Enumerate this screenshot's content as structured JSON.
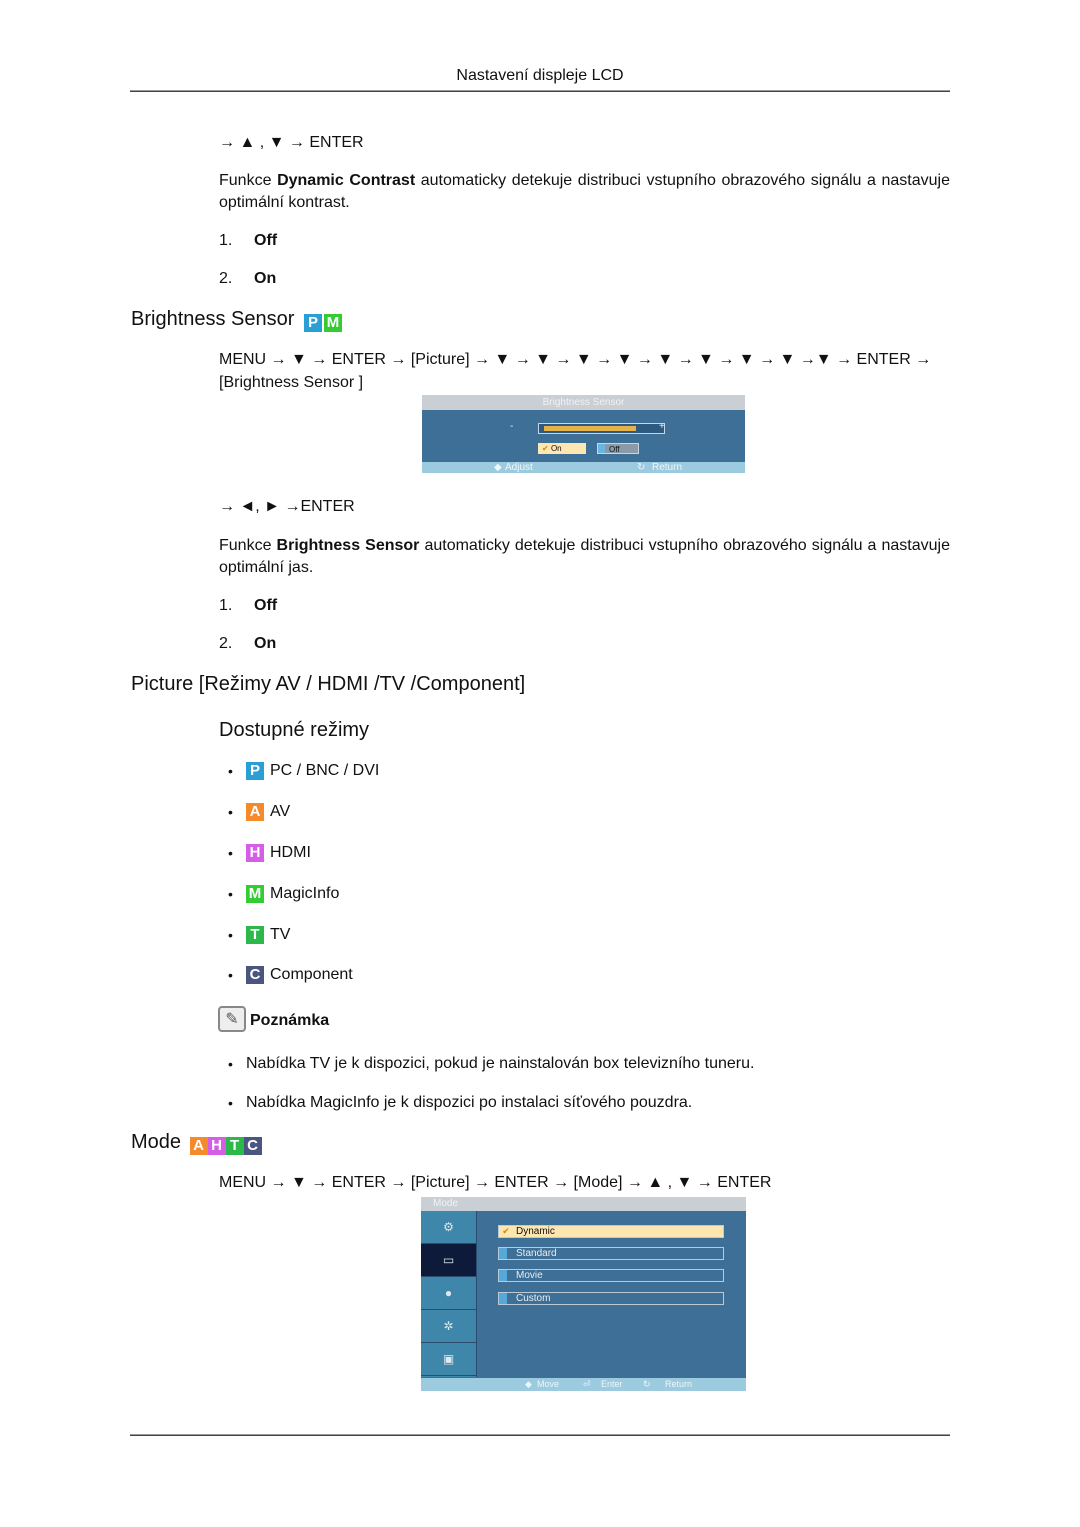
{
  "header": {
    "title": "Nastavení displeje LCD"
  },
  "dynamic_contrast": {
    "nav": "→ ▲ , ▼ → ENTER",
    "desc_prefix": "Funkce ",
    "desc_bold": "Dynamic Contrast",
    "desc_suffix": " automaticky detekuje distribuci vstupního obrazového signálu a nastavuje optimální kontrast.",
    "options": [
      {
        "num": "1.",
        "label": "Off"
      },
      {
        "num": "2.",
        "label": "On"
      }
    ]
  },
  "brightness_sensor": {
    "heading": "Brightness Sensor",
    "badges": [
      {
        "letter": "P",
        "color": "#2a9fd6"
      },
      {
        "letter": "M",
        "color": "#33cc33"
      }
    ],
    "nav_line1": "MENU → ▼ → ENTER → [Picture] → ▼ → ▼ → ▼ → ▼ → ▼ → ▼ → ▼ → ▼ →▼ → ENTER →",
    "nav_line2": "[Brightness Sensor ]",
    "osd": {
      "title": "Brightness Sensor",
      "minus": "-",
      "plus": "+",
      "level_fraction": 0.8,
      "on_label": "On",
      "off_label": "Off",
      "check": "✔",
      "footer_adjust": "Adjust",
      "footer_return": "Return"
    },
    "nav2": "→ ◄, ► →ENTER",
    "desc_prefix": "Funkce ",
    "desc_bold": "Brightness Sensor",
    "desc_suffix": "  automaticky detekuje distribuci vstupního obrazového signálu a nastavuje optimální jas.",
    "options": [
      {
        "num": "1.",
        "label": "Off"
      },
      {
        "num": "2.",
        "label": "On"
      }
    ]
  },
  "picture_modes": {
    "heading": "Picture [Režimy AV / HDMI /TV /Component]",
    "subheading": "Dostupné režimy",
    "bullet": "•",
    "modes": [
      {
        "letter": "P",
        "color": "#2a9fd6",
        "label": "PC / BNC / DVI"
      },
      {
        "letter": "A",
        "color": "#f58a2a",
        "label": "AV"
      },
      {
        "letter": "H",
        "color": "#d65ee6",
        "label": "HDMI"
      },
      {
        "letter": "M",
        "color": "#33cc33",
        "label": "MagicInfo"
      },
      {
        "letter": "T",
        "color": "#2db84a",
        "label": "TV"
      },
      {
        "letter": "C",
        "color": "#4a5580",
        "label": "Component"
      }
    ],
    "note_title": "Poznámka",
    "notes": [
      "Nabídka TV je k dispozici, pokud je nainstalován box televizního tuneru.",
      "Nabídka MagicInfo je k dispozici po instalaci síťového pouzdra."
    ]
  },
  "mode": {
    "heading": "Mode",
    "badges": [
      {
        "letter": "A",
        "color": "#f58a2a"
      },
      {
        "letter": "H",
        "color": "#d65ee6"
      },
      {
        "letter": "T",
        "color": "#2db84a"
      },
      {
        "letter": "C",
        "color": "#4a5580"
      }
    ],
    "nav": "MENU → ▼ → ENTER → [Picture] → ENTER → [Mode] → ▲ , ▼ → ENTER",
    "osd": {
      "title": "Mode",
      "side_icons": [
        "input-icon",
        "picture-icon",
        "sound-icon",
        "setup-icon",
        "multi-control-icon"
      ],
      "options": [
        "Dynamic",
        "Standard",
        "Movie",
        "Custom"
      ],
      "selected": "Dynamic",
      "check": "✔",
      "footer_move": "Move",
      "footer_enter": "Enter",
      "footer_return": "Return"
    }
  }
}
